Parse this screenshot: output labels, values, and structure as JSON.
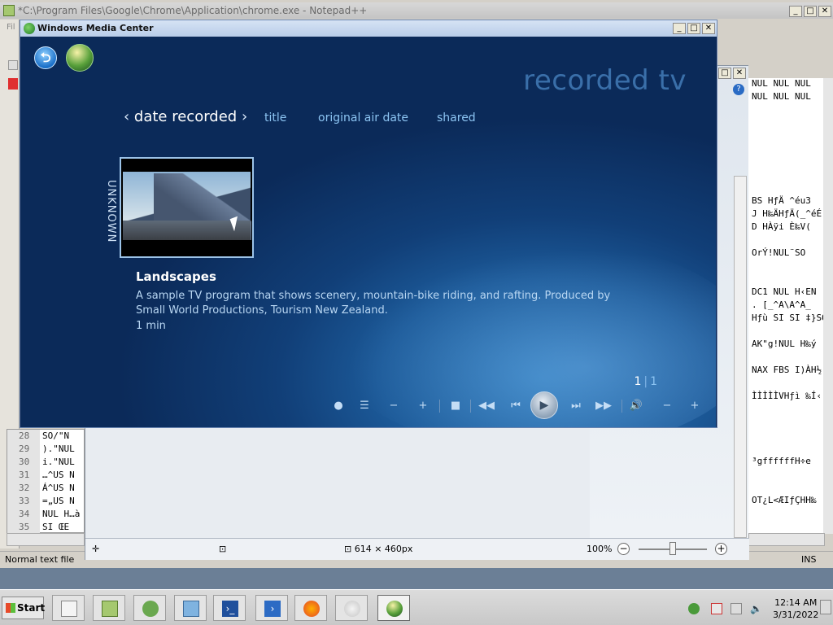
{
  "notepad": {
    "title": "*C:\\Program Files\\Google\\Chrome\\Application\\chrome.exe - Notepad++",
    "menu_first": "Fil",
    "status_left": "Normal text file",
    "status_ins": "INS",
    "lines": [
      {
        "num": "28",
        "text": "SO/\"N"
      },
      {
        "num": "29",
        "text": ").\"NUL"
      },
      {
        "num": "30",
        "text": "i.\"NUL"
      },
      {
        "num": "31",
        "text": "…^US N"
      },
      {
        "num": "32",
        "text": "Á^US N"
      },
      {
        "num": "33",
        "text": "=„US N"
      },
      {
        "num": "34",
        "text": "NUL H…à"
      },
      {
        "num": "35",
        "text": "SI ŒE"
      }
    ],
    "right_pane": [
      "NUL NUL NUL",
      "NUL NUL NUL",
      "BS HƒÄ ^éu3",
      "J H‰ÄHƒÄ(_^éÉ",
      "D HÀÿi  È‰V(",
      "OrÝ!NUL¨SO",
      "DC1 NUL H‹EN",
      ". [_^A\\A^A_",
      "Hƒù SI SI ‡}SO",
      "AK\"g!NUL H‰ý",
      "NAX FBS I)ÀH½",
      "ÌÌÌÌÌVHƒì ‰Í‹",
      "³gffffffH÷e",
      "OT¿L<ÆIƒÇHH‰"
    ]
  },
  "viewer": {
    "dimensions": "614 × 460px",
    "zoom": "100%"
  },
  "wmc": {
    "window_title": "Windows Media Center",
    "page_title": "recorded tv",
    "sort_active": "date recorded",
    "sort_options": [
      "title",
      "original air date",
      "shared"
    ],
    "group_label": "UNKNOWN",
    "program": {
      "title": "Landscapes",
      "description": "A sample TV program that shows scenery, mountain-bike riding, and rafting. Produced by Small World Productions, Tourism New Zealand.",
      "duration": "1 min"
    },
    "pager": {
      "current": "1",
      "total": "1"
    }
  },
  "taskbar": {
    "start_label": "Start",
    "time": "12:14 AM",
    "date": "3/31/2022"
  },
  "colors": {
    "wmc_accent": "#8cc4f2",
    "wmc_bg_dark": "#0b2a59",
    "wmc_bg_light": "#2d78b8"
  }
}
